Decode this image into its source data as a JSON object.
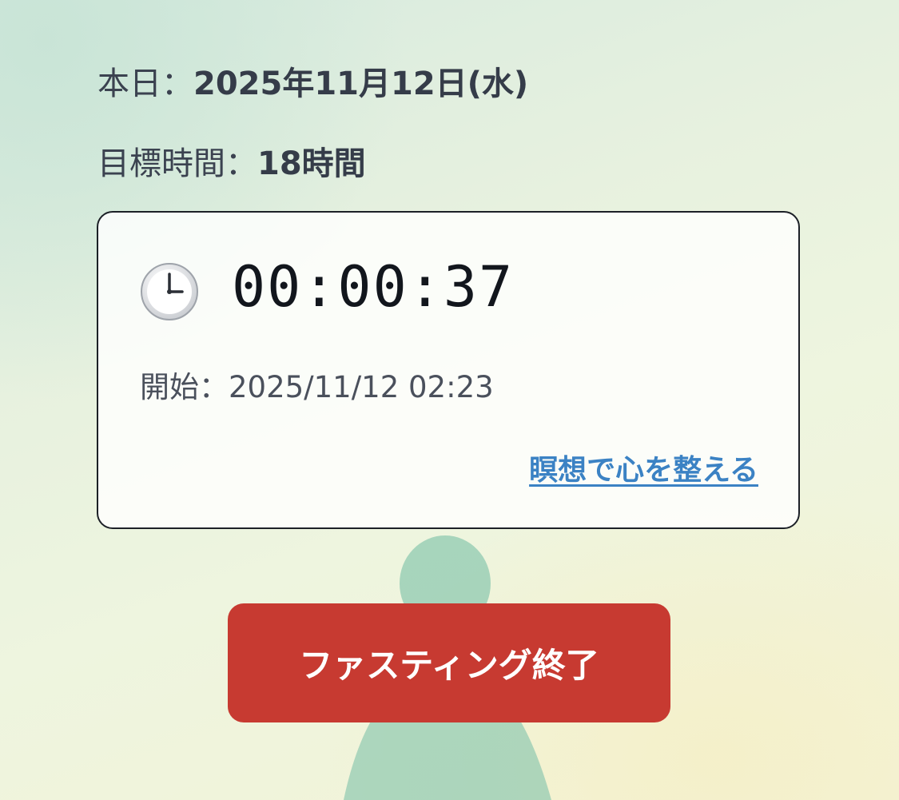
{
  "today": {
    "label": "本日：",
    "value": "2025年11月12日(水)"
  },
  "goal": {
    "label": "目標時間：",
    "value": "18時間"
  },
  "timer": {
    "icon": "clock-icon",
    "elapsed": "00:00:37",
    "start_label": "開始：",
    "start_value": "2025/11/12 02:23",
    "meditate_link": "瞑想で心を整える"
  },
  "actions": {
    "end_button": "ファスティング終了",
    "end_button_color": "#c73a31"
  },
  "colors": {
    "link": "#3b82c4",
    "figure": "#8fc9b0"
  }
}
